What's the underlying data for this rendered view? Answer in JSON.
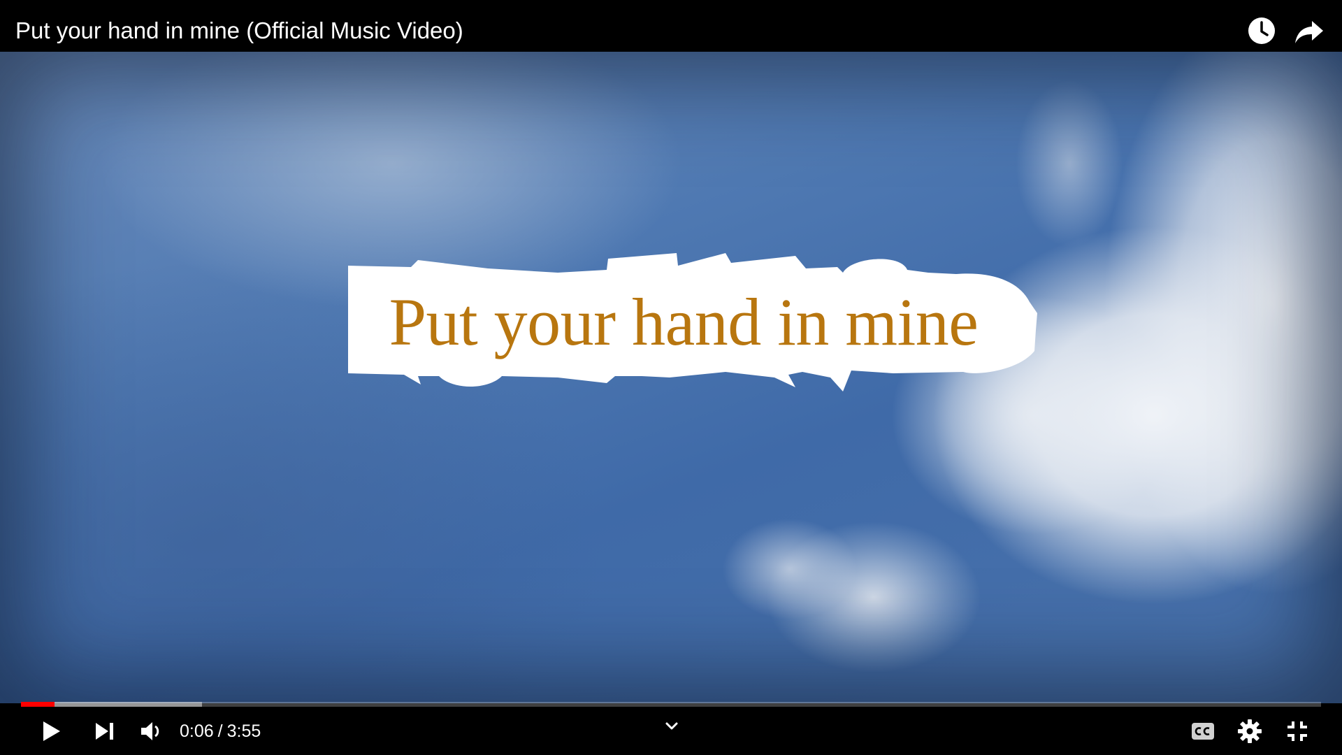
{
  "video": {
    "title": "Put your hand in mine (Official Music Video)",
    "overlay_text": "Put your hand in mine"
  },
  "player": {
    "current_time": "0:06",
    "separator": "/",
    "duration": "3:55",
    "played_fraction": 0.026,
    "buffered_fraction": 0.139
  },
  "icons": {
    "watch_later": "clock-icon",
    "share": "share-arrow-icon",
    "play": "play-icon",
    "next": "skip-next-icon",
    "volume": "volume-icon",
    "expand": "chevron-down-icon",
    "captions": "cc-icon",
    "settings": "gear-icon",
    "fullscreen_exit": "fullscreen-exit-icon"
  },
  "colors": {
    "accent": "#ff0000",
    "overlay_text": "#b8760f",
    "background": "#000000"
  }
}
